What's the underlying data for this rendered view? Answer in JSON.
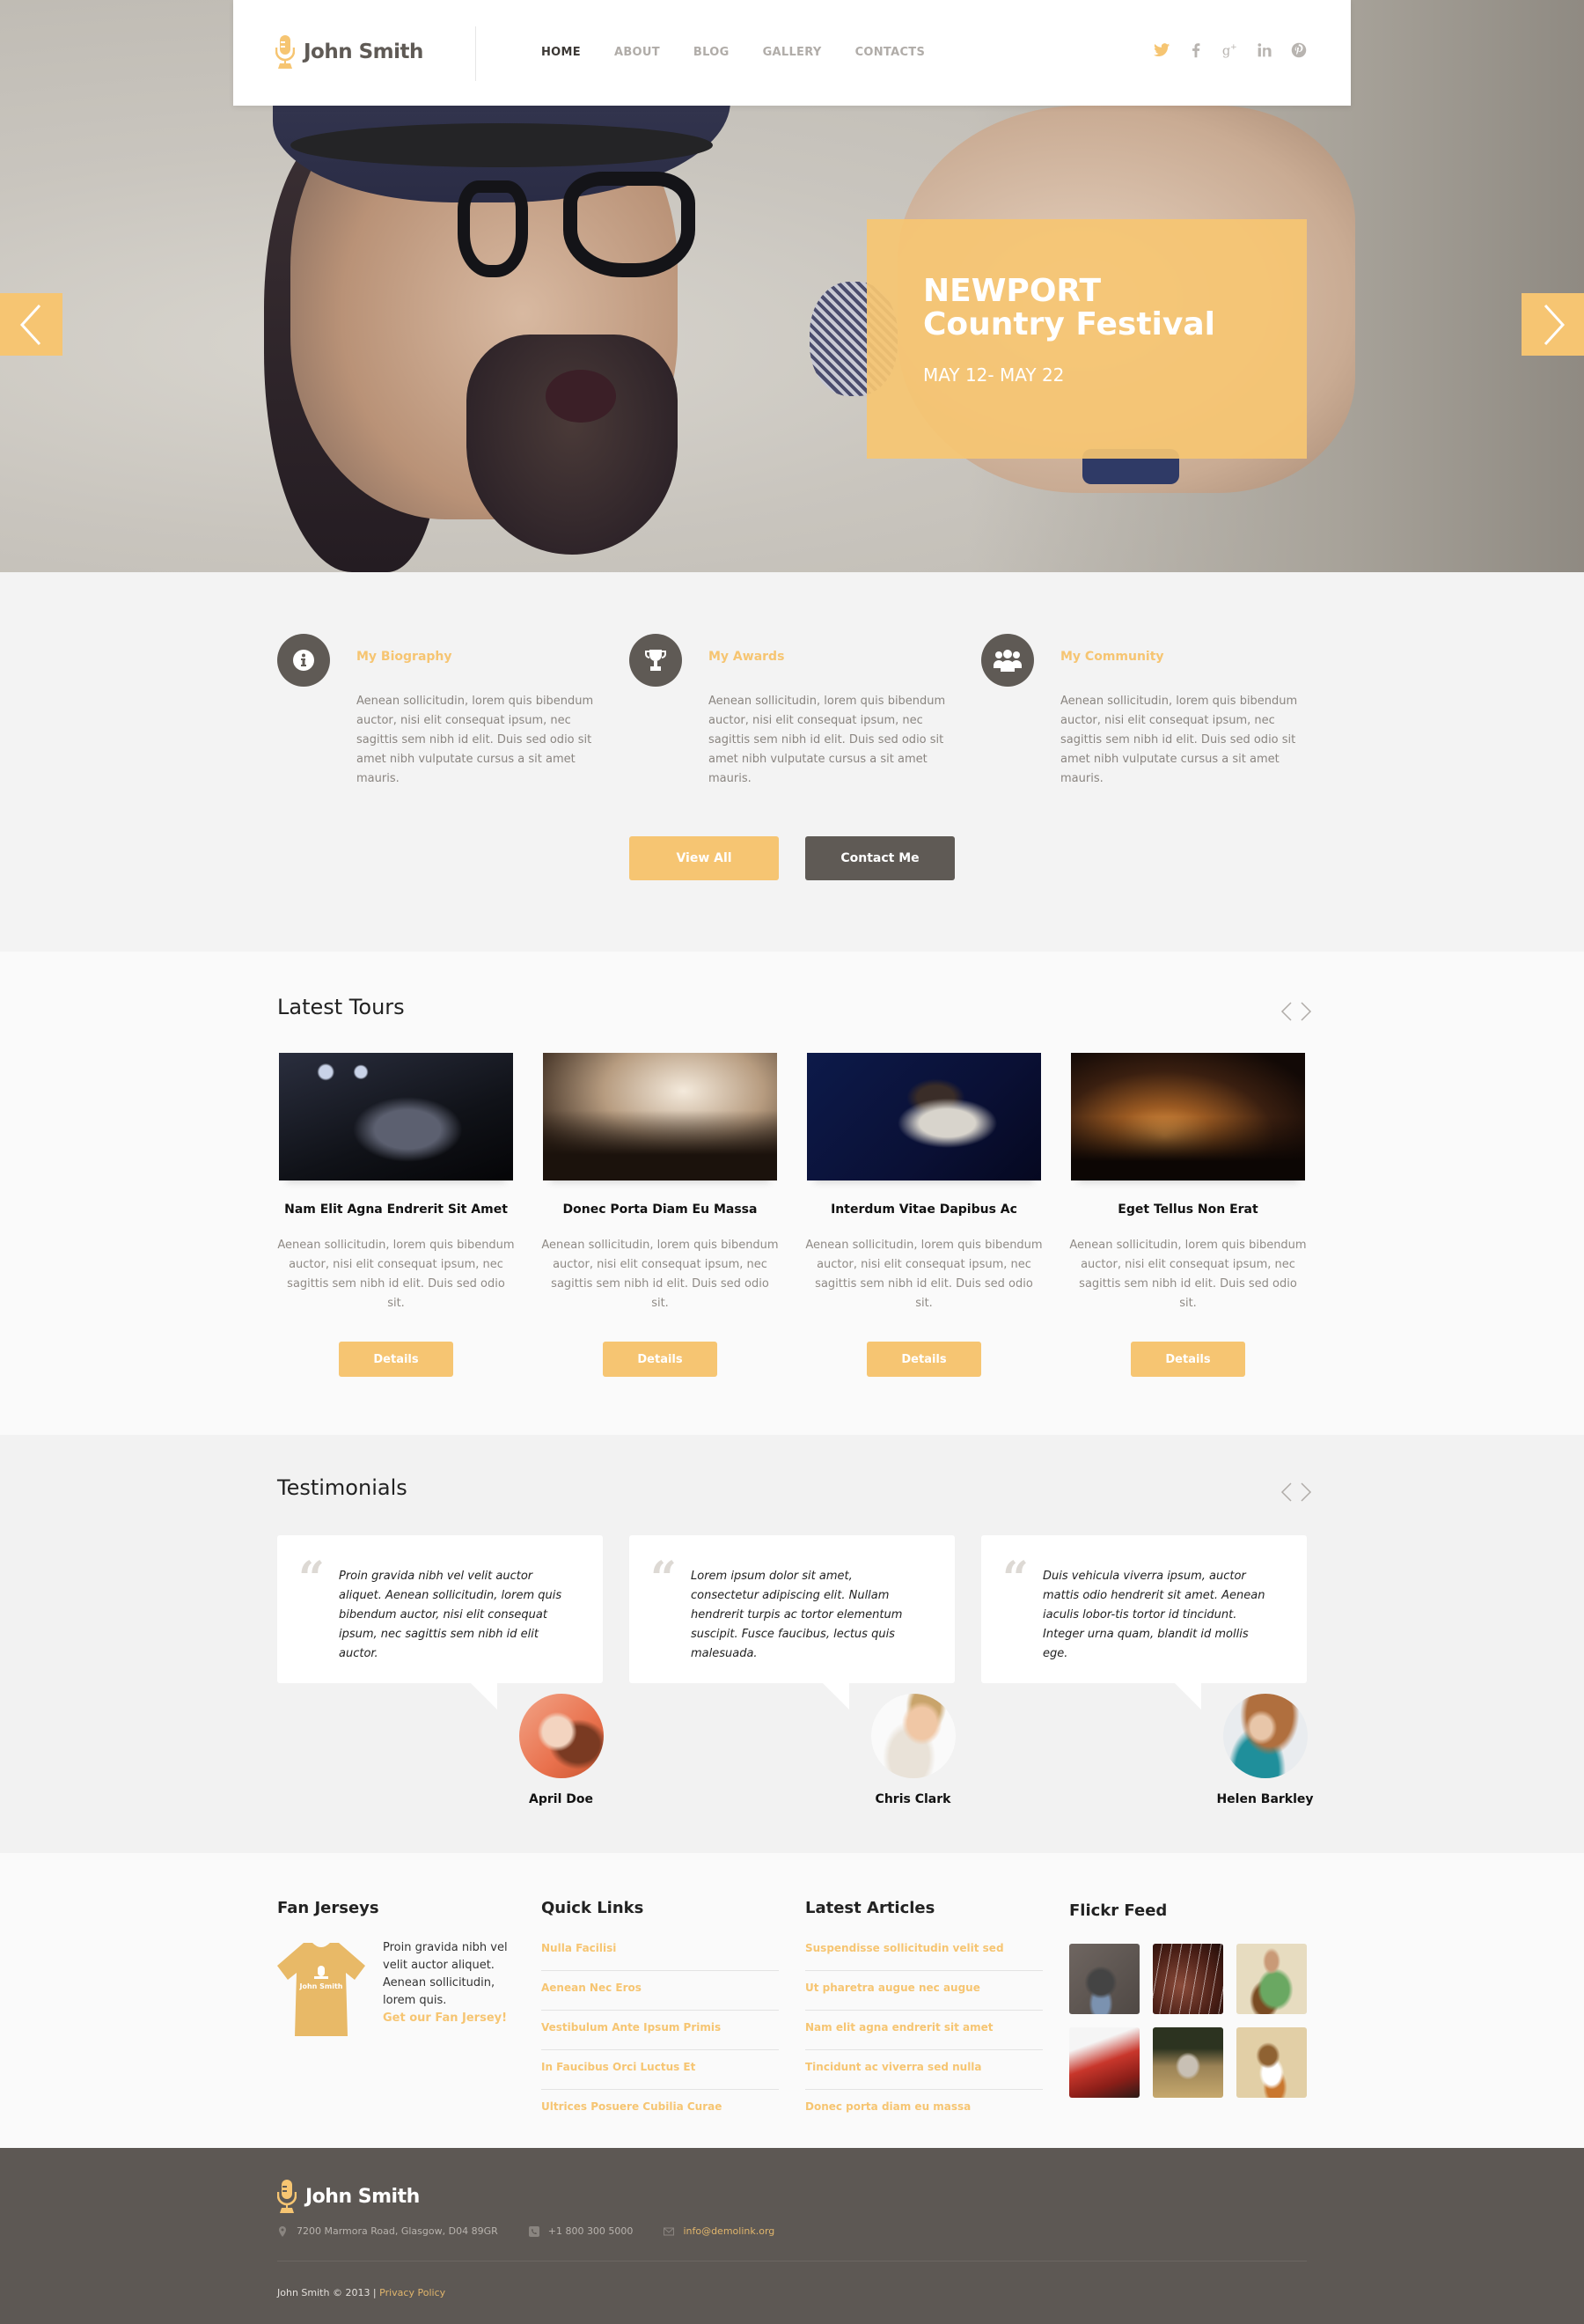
{
  "brand": {
    "name": "John Smith",
    "accent_color": "#f6c572",
    "dark_color": "#5f5a55"
  },
  "header": {
    "nav": [
      {
        "label": "HOME",
        "active": true
      },
      {
        "label": "ABOUT",
        "active": false
      },
      {
        "label": "BLOG",
        "active": false
      },
      {
        "label": "GALLERY",
        "active": false
      },
      {
        "label": "CONTACTS",
        "active": false
      }
    ],
    "social": [
      "twitter-icon",
      "facebook-icon",
      "google-plus-icon",
      "linkedin-icon",
      "pinterest-icon"
    ]
  },
  "hero": {
    "title_line1": "NEWPORT",
    "title_line2": "Country Festival",
    "date": "MAY 12- MAY 22",
    "prev_icon": "chevron-left-icon",
    "next_icon": "chevron-right-icon"
  },
  "features": {
    "items": [
      {
        "icon": "info-icon",
        "title": "My Biography",
        "text": "Aenean sollicitudin, lorem quis bibendum auctor, nisi elit consequat ipsum, nec sagittis sem nibh id elit. Duis sed odio sit amet nibh vulputate cursus a sit amet mauris."
      },
      {
        "icon": "trophy-icon",
        "title": "My Awards",
        "text": "Aenean sollicitudin, lorem quis bibendum auctor, nisi elit consequat ipsum, nec sagittis sem nibh id elit. Duis sed odio sit amet nibh vulputate cursus a sit amet mauris."
      },
      {
        "icon": "users-icon",
        "title": "My Community",
        "text": "Aenean sollicitudin, lorem quis bibendum auctor, nisi elit consequat ipsum, nec sagittis sem nibh id elit. Duis sed odio sit amet nibh vulputate cursus a sit amet mauris."
      }
    ],
    "view_all_label": "View All",
    "contact_label": "Contact Me"
  },
  "tours": {
    "title": "Latest Tours",
    "items": [
      {
        "title": "Nam Elit Agna Endrerit Sit Amet",
        "text": "Aenean sollicitudin, lorem quis bibendum auctor, nisi elit consequat ipsum, nec sagittis sem nibh id elit. Duis sed odio sit.",
        "button": "Details"
      },
      {
        "title": "Donec Porta Diam Eu Massa",
        "text": "Aenean sollicitudin, lorem quis bibendum auctor, nisi elit consequat ipsum, nec sagittis sem nibh id elit. Duis sed odio sit.",
        "button": "Details"
      },
      {
        "title": "Interdum Vitae Dapibus Ac",
        "text": "Aenean sollicitudin, lorem quis bibendum auctor, nisi elit consequat ipsum, nec sagittis sem nibh id elit. Duis sed odio sit.",
        "button": "Details"
      },
      {
        "title": "Eget Tellus Non Erat",
        "text": "Aenean sollicitudin, lorem quis bibendum auctor, nisi elit consequat ipsum, nec sagittis sem nibh id elit. Duis sed odio sit.",
        "button": "Details"
      }
    ]
  },
  "testimonials": {
    "title": "Testimonials",
    "items": [
      {
        "quote": "Proin gravida nibh vel velit auctor aliquet. Aenean sollicitudin, lorem quis bibendum auctor, nisi elit consequat ipsum, nec sagittis sem nibh id elit auctor.",
        "name": "April Doe"
      },
      {
        "quote": "Lorem ipsum dolor sit amet, consectetur adipiscing elit. Nullam hendrerit turpis ac tortor elementum suscipit. Fusce faucibus, lectus quis malesuada.",
        "name": "Chris Clark"
      },
      {
        "quote": "Duis vehicula viverra ipsum, auctor mattis odio hendrerit sit amet. Aenean iaculis lobor-tis tortor id tincidunt. Integer urna quam, blandit id mollis ege.",
        "name": "Helen Barkley"
      }
    ]
  },
  "widgets": {
    "fan_jerseys": {
      "title": "Fan Jerseys",
      "shirt_label": "John Smith",
      "text": "Proin gravida nibh vel velit auctor aliquet. Aenean sollicitudin, lorem quis.",
      "link": "Get our Fan Jersey!"
    },
    "quick_links": {
      "title": "Quick Links",
      "items": [
        "Nulla Facilisi",
        "Aenean Nec Eros",
        "Vestibulum Ante Ipsum Primis",
        "In Faucibus Orci Luctus Et",
        "Ultrices Posuere Cubilia Curae"
      ]
    },
    "latest_articles": {
      "title": "Latest Articles",
      "items": [
        "Suspendisse sollicitudin velit sed",
        "Ut pharetra augue nec augue",
        "Nam elit agna endrerit sit amet",
        "Tincidunt ac viverra sed nulla",
        "Donec porta diam eu massa"
      ]
    },
    "flickr": {
      "title": "Flickr Feed",
      "count": 6
    }
  },
  "footer": {
    "brand": "John Smith",
    "address": "7200  Marmora Road, Glasgow, D04 89GR",
    "phone": "+1 800 300 5000",
    "email": "info@demolink.org",
    "copyright": "John Smith © 2013  |",
    "privacy": "Privacy Policy"
  }
}
